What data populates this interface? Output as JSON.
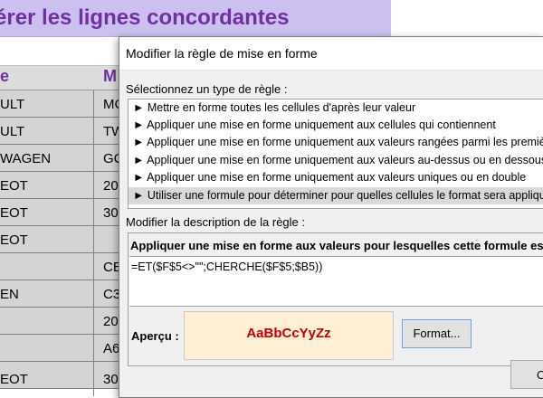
{
  "sheet": {
    "title": "érer les lignes concordantes",
    "headers": [
      "e",
      "M"
    ],
    "col_a": [
      "ULT",
      "ULT",
      "WAGEN",
      "EOT",
      "EOT",
      "EOT",
      "",
      "EN",
      "",
      "",
      "EOT"
    ],
    "col_b": [
      "MC",
      "TW",
      "GC",
      "20",
      "30",
      "",
      "CE",
      "C3",
      "20",
      "A6",
      "30"
    ]
  },
  "dialog": {
    "title": "Modifier la règle de mise en forme",
    "select_type_label": "Sélectionnez un type de règle :",
    "rule_types": [
      "► Mettre en forme toutes les cellules d'après leur valeur",
      "► Appliquer une mise en forme uniquement aux cellules qui contiennent",
      "► Appliquer une mise en forme uniquement aux valeurs rangées parmi les premières ou les dernières valeurs",
      "► Appliquer une mise en forme uniquement aux valeurs au-dessus ou en dessous de la moyenne",
      "► Appliquer une mise en forme uniquement aux valeurs uniques ou en double",
      "► Utiliser une formule pour déterminer pour quelles cellules le format sera appliqué"
    ],
    "selected_index": 5,
    "description_label": "Modifier la description de la règle :",
    "formula_heading": "Appliquer une mise en forme aux valeurs pour lesquelles cette formule est vraie :",
    "formula": "=ET($F$5<>\"\";CHERCHE($F$5;$B5))",
    "preview_label": "Aperçu :",
    "preview_text": "AaBbCcYyZz",
    "format_button": "Format...",
    "ok_button": "OK"
  }
}
